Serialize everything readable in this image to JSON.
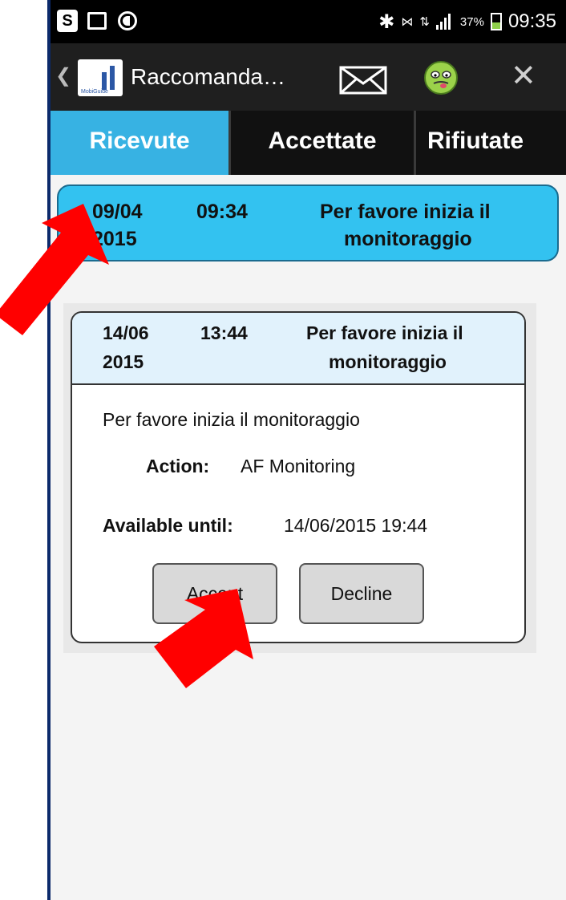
{
  "status_bar": {
    "battery": "37%",
    "time": "09:35"
  },
  "action_bar": {
    "title": "Raccomanda…",
    "logo_text": "MobiGuide",
    "icons": [
      "back-icon",
      "app-logo",
      "mail-icon",
      "smiley-icon",
      "close-icon"
    ]
  },
  "tabs": [
    {
      "label": "Ricevute",
      "active": true
    },
    {
      "label": "Accettate",
      "active": false
    },
    {
      "label": "Rifiutate",
      "active": false
    }
  ],
  "list": {
    "row": {
      "date": "09/04",
      "year": "2015",
      "time": "09:34",
      "message_line1": "Per favore inizia il",
      "message_line2": "monitoraggio"
    }
  },
  "dialog": {
    "header": {
      "date": "14/06",
      "year": "2015",
      "time": "13:44",
      "message_line1": "Per favore inizia il",
      "message_line2": "monitoraggio"
    },
    "body_text": "Per favore inizia il monitoraggio",
    "action_label": "Action:",
    "action_value": "AF Monitoring",
    "available_label": "Available until:",
    "available_value": "14/06/2015 19:44",
    "accept_button": "Accept",
    "decline_button": "Decline"
  },
  "colors": {
    "accent": "#37b2e3",
    "selected_row": "#33c2f0",
    "dialog_header": "#e1f2fc",
    "arrow": "#ff0000"
  }
}
